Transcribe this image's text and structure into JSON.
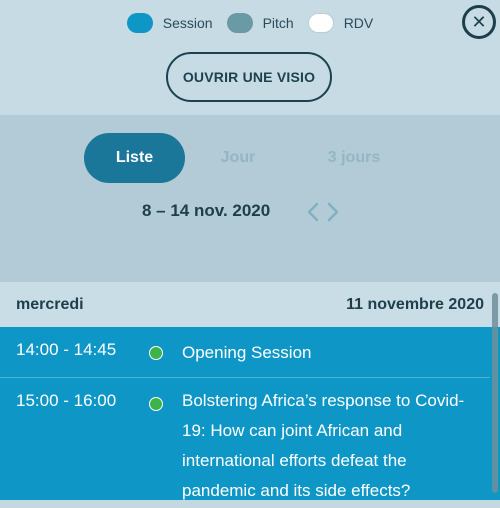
{
  "legend": {
    "items": [
      {
        "label": "Session",
        "color": "#0e97c6"
      },
      {
        "label": "Pitch",
        "color": "#6a9aa6"
      },
      {
        "label": "RDV",
        "color": "#ffffff"
      }
    ]
  },
  "close_glyph": "✕",
  "visio_button": "OUVRIR UNE VISIO",
  "tabs": [
    {
      "label": "Liste",
      "active": true
    },
    {
      "label": "Jour",
      "active": false
    },
    {
      "label": "3 jours",
      "active": false
    }
  ],
  "date_range": "8 – 14 nov. 2020",
  "day": {
    "name": "mercredi",
    "date": "11 novembre 2020"
  },
  "events": [
    {
      "time": "14:00 - 14:45",
      "title": "Opening Session",
      "status_color": "#3cb44a"
    },
    {
      "time": "15:00 - 16:00",
      "title": "Bolstering Africa’s response to Covid-19: How can joint African and international efforts defeat the pandemic and its side effects?",
      "status_color": "#3cb44a"
    }
  ]
}
